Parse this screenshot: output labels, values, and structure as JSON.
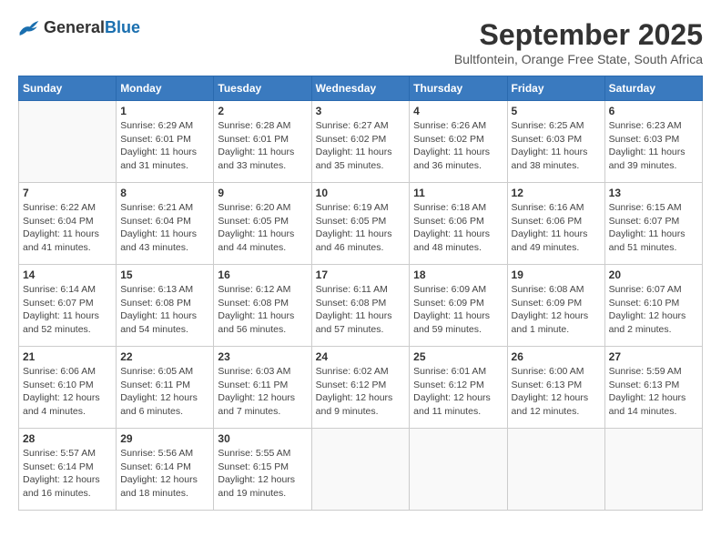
{
  "logo": {
    "general": "General",
    "blue": "Blue"
  },
  "title": "September 2025",
  "subtitle": "Bultfontein, Orange Free State, South Africa",
  "weekdays": [
    "Sunday",
    "Monday",
    "Tuesday",
    "Wednesday",
    "Thursday",
    "Friday",
    "Saturday"
  ],
  "weeks": [
    [
      {
        "day": null,
        "info": null
      },
      {
        "day": "1",
        "info": "Sunrise: 6:29 AM\nSunset: 6:01 PM\nDaylight: 11 hours and 31 minutes."
      },
      {
        "day": "2",
        "info": "Sunrise: 6:28 AM\nSunset: 6:01 PM\nDaylight: 11 hours and 33 minutes."
      },
      {
        "day": "3",
        "info": "Sunrise: 6:27 AM\nSunset: 6:02 PM\nDaylight: 11 hours and 35 minutes."
      },
      {
        "day": "4",
        "info": "Sunrise: 6:26 AM\nSunset: 6:02 PM\nDaylight: 11 hours and 36 minutes."
      },
      {
        "day": "5",
        "info": "Sunrise: 6:25 AM\nSunset: 6:03 PM\nDaylight: 11 hours and 38 minutes."
      },
      {
        "day": "6",
        "info": "Sunrise: 6:23 AM\nSunset: 6:03 PM\nDaylight: 11 hours and 39 minutes."
      }
    ],
    [
      {
        "day": "7",
        "info": "Sunrise: 6:22 AM\nSunset: 6:04 PM\nDaylight: 11 hours and 41 minutes."
      },
      {
        "day": "8",
        "info": "Sunrise: 6:21 AM\nSunset: 6:04 PM\nDaylight: 11 hours and 43 minutes."
      },
      {
        "day": "9",
        "info": "Sunrise: 6:20 AM\nSunset: 6:05 PM\nDaylight: 11 hours and 44 minutes."
      },
      {
        "day": "10",
        "info": "Sunrise: 6:19 AM\nSunset: 6:05 PM\nDaylight: 11 hours and 46 minutes."
      },
      {
        "day": "11",
        "info": "Sunrise: 6:18 AM\nSunset: 6:06 PM\nDaylight: 11 hours and 48 minutes."
      },
      {
        "day": "12",
        "info": "Sunrise: 6:16 AM\nSunset: 6:06 PM\nDaylight: 11 hours and 49 minutes."
      },
      {
        "day": "13",
        "info": "Sunrise: 6:15 AM\nSunset: 6:07 PM\nDaylight: 11 hours and 51 minutes."
      }
    ],
    [
      {
        "day": "14",
        "info": "Sunrise: 6:14 AM\nSunset: 6:07 PM\nDaylight: 11 hours and 52 minutes."
      },
      {
        "day": "15",
        "info": "Sunrise: 6:13 AM\nSunset: 6:08 PM\nDaylight: 11 hours and 54 minutes."
      },
      {
        "day": "16",
        "info": "Sunrise: 6:12 AM\nSunset: 6:08 PM\nDaylight: 11 hours and 56 minutes."
      },
      {
        "day": "17",
        "info": "Sunrise: 6:11 AM\nSunset: 6:08 PM\nDaylight: 11 hours and 57 minutes."
      },
      {
        "day": "18",
        "info": "Sunrise: 6:09 AM\nSunset: 6:09 PM\nDaylight: 11 hours and 59 minutes."
      },
      {
        "day": "19",
        "info": "Sunrise: 6:08 AM\nSunset: 6:09 PM\nDaylight: 12 hours and 1 minute."
      },
      {
        "day": "20",
        "info": "Sunrise: 6:07 AM\nSunset: 6:10 PM\nDaylight: 12 hours and 2 minutes."
      }
    ],
    [
      {
        "day": "21",
        "info": "Sunrise: 6:06 AM\nSunset: 6:10 PM\nDaylight: 12 hours and 4 minutes."
      },
      {
        "day": "22",
        "info": "Sunrise: 6:05 AM\nSunset: 6:11 PM\nDaylight: 12 hours and 6 minutes."
      },
      {
        "day": "23",
        "info": "Sunrise: 6:03 AM\nSunset: 6:11 PM\nDaylight: 12 hours and 7 minutes."
      },
      {
        "day": "24",
        "info": "Sunrise: 6:02 AM\nSunset: 6:12 PM\nDaylight: 12 hours and 9 minutes."
      },
      {
        "day": "25",
        "info": "Sunrise: 6:01 AM\nSunset: 6:12 PM\nDaylight: 12 hours and 11 minutes."
      },
      {
        "day": "26",
        "info": "Sunrise: 6:00 AM\nSunset: 6:13 PM\nDaylight: 12 hours and 12 minutes."
      },
      {
        "day": "27",
        "info": "Sunrise: 5:59 AM\nSunset: 6:13 PM\nDaylight: 12 hours and 14 minutes."
      }
    ],
    [
      {
        "day": "28",
        "info": "Sunrise: 5:57 AM\nSunset: 6:14 PM\nDaylight: 12 hours and 16 minutes."
      },
      {
        "day": "29",
        "info": "Sunrise: 5:56 AM\nSunset: 6:14 PM\nDaylight: 12 hours and 18 minutes."
      },
      {
        "day": "30",
        "info": "Sunrise: 5:55 AM\nSunset: 6:15 PM\nDaylight: 12 hours and 19 minutes."
      },
      {
        "day": null,
        "info": null
      },
      {
        "day": null,
        "info": null
      },
      {
        "day": null,
        "info": null
      },
      {
        "day": null,
        "info": null
      }
    ]
  ]
}
